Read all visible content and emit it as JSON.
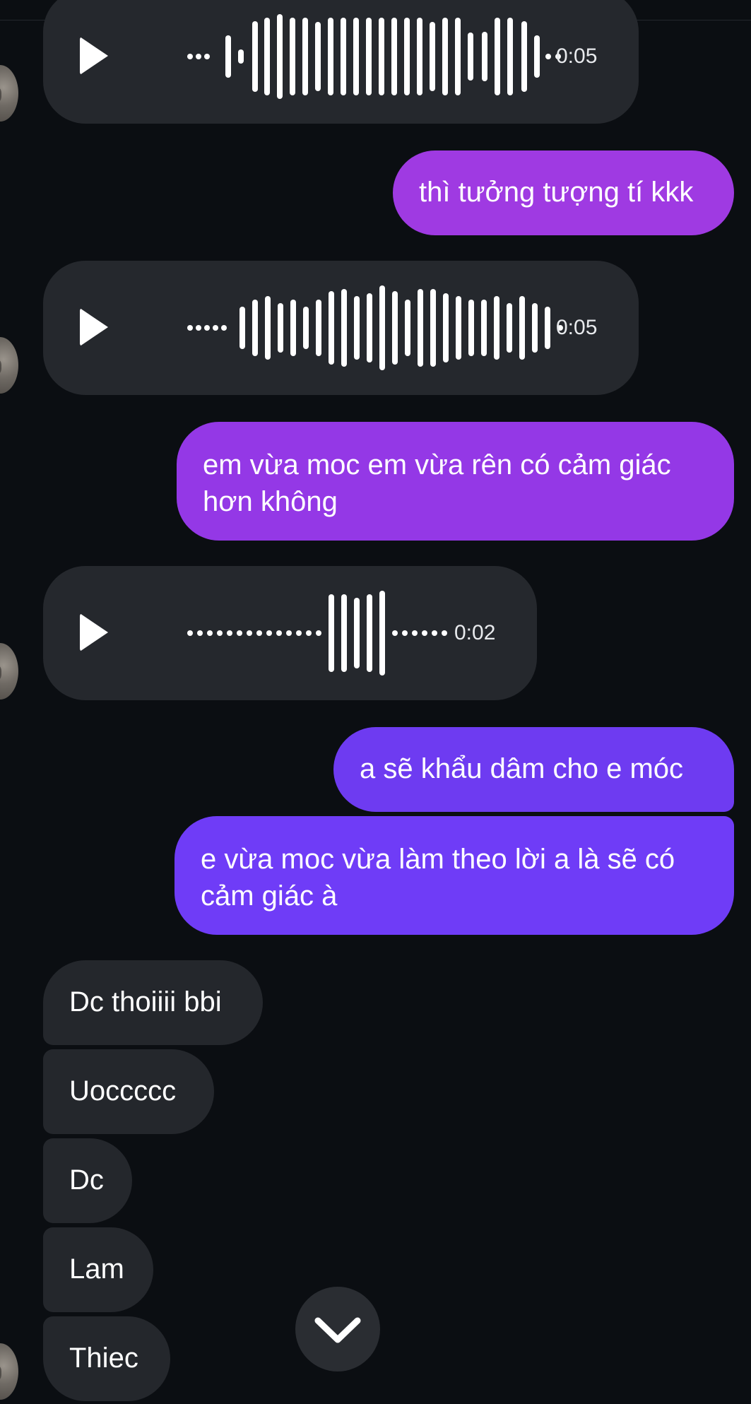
{
  "thread": {
    "messages": [
      {
        "kind": "voice",
        "direction": "incoming",
        "duration": "0:05"
      },
      {
        "kind": "text",
        "direction": "outgoing",
        "text": "thì tưởng tượng tí kkk"
      },
      {
        "kind": "voice",
        "direction": "incoming",
        "duration": "0:05"
      },
      {
        "kind": "text",
        "direction": "outgoing",
        "text": "em vừa moc em vừa rên có cảm giác hơn không"
      },
      {
        "kind": "voice",
        "direction": "incoming",
        "duration": "0:02"
      },
      {
        "kind": "text",
        "direction": "outgoing",
        "text": "a sẽ khẩu dâm cho e móc"
      },
      {
        "kind": "text",
        "direction": "outgoing",
        "text": "e vừa moc vừa làm theo lời a là sẽ có cảm giác à"
      },
      {
        "kind": "text",
        "direction": "incoming",
        "text": "Dc thoiiii bbi"
      },
      {
        "kind": "text",
        "direction": "incoming",
        "text": "Uoccccc"
      },
      {
        "kind": "text",
        "direction": "incoming",
        "text": "Dc"
      },
      {
        "kind": "text",
        "direction": "incoming",
        "text": "Lam"
      },
      {
        "kind": "text",
        "direction": "incoming",
        "text": "Thiec"
      }
    ]
  },
  "icons": {
    "play": "play-icon",
    "waveform": "waveform-icon",
    "scroll_down": "chevron-down-icon",
    "avatar": "contact-avatar"
  },
  "colors": {
    "background": "#0b0e12",
    "incoming_bubble": "#24272c",
    "outgoing_purple": "#9b3ae3",
    "outgoing_violet": "#6f3cf7",
    "text": "#ffffff"
  }
}
